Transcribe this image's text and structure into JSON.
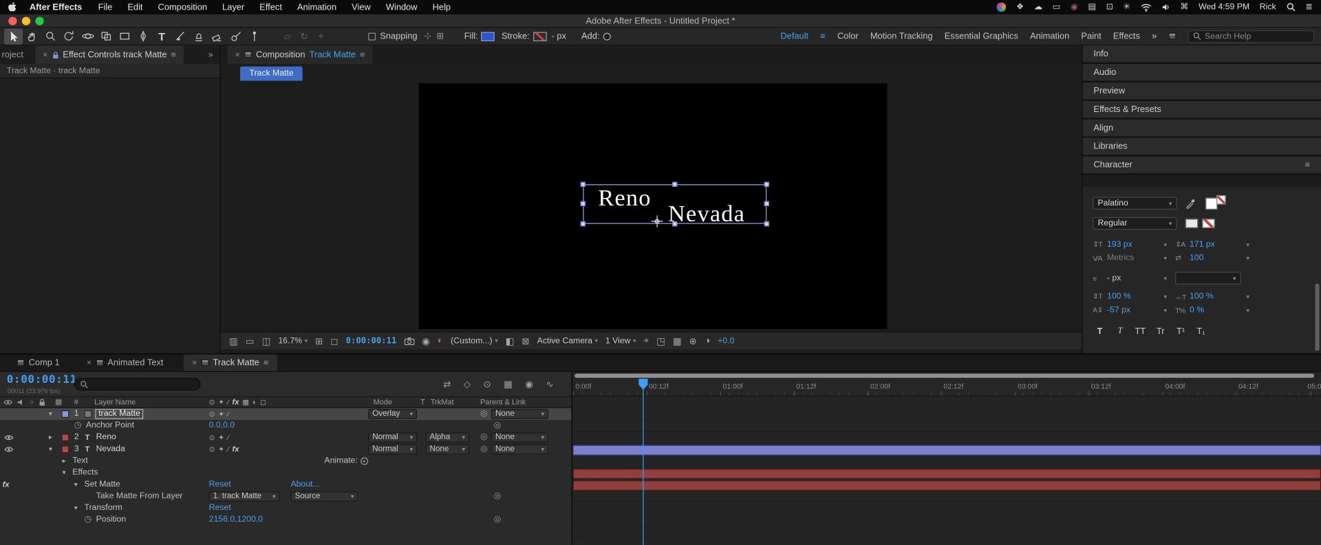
{
  "menubar": {
    "app_name": "After Effects",
    "m_file": "File",
    "m_edit": "Edit",
    "m_composition": "Composition",
    "m_layer": "Layer",
    "m_effect": "Effect",
    "m_animation": "Animation",
    "m_view": "View",
    "m_window": "Window",
    "m_help": "Help",
    "clock": "Wed 4:59 PM",
    "user": "Rick"
  },
  "titlebar": {
    "title": "Adobe After Effects - Untitled Project *"
  },
  "toolbar": {
    "snapping": "Snapping",
    "fill": "Fill:",
    "stroke": "Stroke:",
    "stroke_size": "- px",
    "add": "Add:",
    "ws_default": "Default",
    "ws_color": "Color",
    "ws_motion": "Motion Tracking",
    "ws_essential": "Essential Graphics",
    "ws_animation": "Animation",
    "ws_paint": "Paint",
    "ws_effects": "Effects",
    "overflow": "»",
    "search_placeholder": "Search Help"
  },
  "left_panel": {
    "project_tab": "roject",
    "effect_controls_tab": "Effect Controls track Matte",
    "breadcrumb": "Track Matte · track Matte",
    "overflow": "»"
  },
  "comp": {
    "tab_label": "Composition",
    "comp_name": "Track Matte",
    "nav_tab": "Track Matte",
    "text_line1": "Reno",
    "text_line2": "Nevada",
    "zoom": "16.7%",
    "timecode": "0:00:00:11",
    "resolution": "(Custom...)",
    "camera": "Active Camera",
    "views": "1 View",
    "exposure": "+0.0"
  },
  "sidebar": {
    "p_info": "Info",
    "p_audio": "Audio",
    "p_preview": "Preview",
    "p_effects": "Effects & Presets",
    "p_align": "Align",
    "p_libraries": "Libraries",
    "p_character": "Character",
    "font_family": "Palatino",
    "font_style": "Regular",
    "font_size": "193 px",
    "leading": "171 px",
    "kerning": "Metrics",
    "tracking": "100",
    "stroke_width": "- px",
    "v_scale": "100 %",
    "h_scale": "100 %",
    "baseline_shift": "-57 px",
    "tsume": "0 %",
    "tg_bold": "T",
    "tg_italic": "T",
    "tg_caps": "TT",
    "tg_smallcaps": "Tr",
    "tg_super": "T¹",
    "tg_sub": "T₁"
  },
  "timeline": {
    "tab_comp1": "Comp 1",
    "tab_animated": "Animated Text",
    "tab_track": "Track Matte",
    "timecode": "0:00:00:11",
    "frames": "00011 (23.976 fps)",
    "h_num": "#",
    "h_name": "Layer Name",
    "h_mode": "Mode",
    "h_t": "T",
    "h_trkmat": "TrkMat",
    "h_parent": "Parent & Link",
    "fx": "fx",
    "r1_num": "1",
    "r1_name": "track Matte",
    "r1_mode": "Overlay",
    "r1_parent": "None",
    "r2_label": "Anchor Point",
    "r2_value": "0.0,0.0",
    "r3_num": "2",
    "r3_name": "Reno",
    "r3_mode": "Normal",
    "r3_trkmat": "Alpha",
    "r3_parent": "None",
    "r4_num": "3",
    "r4_name": "Nevada",
    "r4_mode": "Normal",
    "r4_trkmat": "None",
    "r4_parent": "None",
    "r5_label": "Text",
    "r5_animate": "Animate:",
    "r6_label": "Effects",
    "r7_label": "Set Matte",
    "r7_reset": "Reset",
    "r7_about": "About...",
    "r8_label": "Take Matte From Layer",
    "r8_layer": "1. track Matte",
    "r8_channel": "Source",
    "r9_label": "Transform",
    "r9_reset": "Reset",
    "r10_label": "Position",
    "r10_value": "2156.0,1200.0",
    "t0": "0:00f",
    "t1": "00:12f",
    "t2": "01:00f",
    "t3": "01:12f",
    "t4": "02:00f",
    "t5": "02:12f",
    "t6": "03:00f",
    "t7": "03:12f",
    "t8": "04:00f",
    "t9": "04:12f",
    "t10": "05:0"
  }
}
